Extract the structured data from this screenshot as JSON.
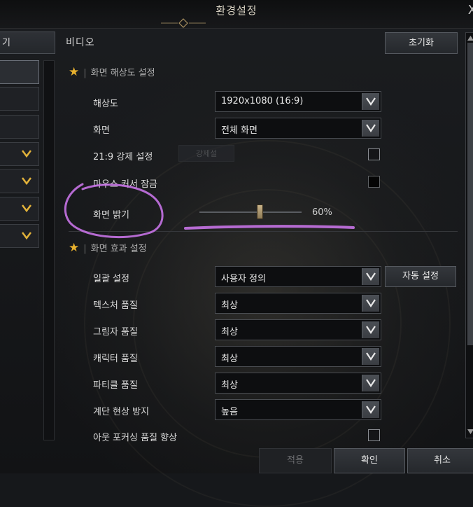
{
  "window": {
    "title": "환경설정"
  },
  "sidebar": {
    "header_label": "기"
  },
  "panel": {
    "section_title": "비디오",
    "reset_label": "초기화",
    "resolution_group": {
      "title": "화면 해상도 설정",
      "rows": [
        {
          "label": "해상도",
          "value": "1920x1080 (16:9)"
        },
        {
          "label": "화면",
          "value": "전체 화면"
        },
        {
          "label": "21:9 강제 설정",
          "checked": false
        },
        {
          "label": "마우스 커서 잠금",
          "checked": false
        },
        {
          "label": "화면 밝기",
          "slider_value_text": "60%",
          "slider_level": 0.6
        }
      ],
      "faint_button_label": "강제설"
    },
    "effects_group": {
      "title": "화면 효과 설정",
      "auto_label": "자동 설정",
      "rows": [
        {
          "label": "일괄 설정",
          "value": "사용자 정의"
        },
        {
          "label": "텍스처 품질",
          "value": "최상"
        },
        {
          "label": "그림자 품질",
          "value": "최상"
        },
        {
          "label": "캐릭터 품질",
          "value": "최상"
        },
        {
          "label": "파티클 품질",
          "value": "최상"
        },
        {
          "label": "계단 현상 방지",
          "value": "높음"
        },
        {
          "label": "아웃 포커싱 품질 향상",
          "checked": false
        }
      ]
    }
  },
  "footer": {
    "apply_label": "적용",
    "ok_label": "확인",
    "cancel_label": "취소"
  },
  "colors": {
    "accent_gold": "#e8b12e",
    "annotation_purple": "#c673e6"
  },
  "icons": {
    "star": "star-icon",
    "chevron": "chevron-down-icon",
    "close": "close-icon"
  }
}
